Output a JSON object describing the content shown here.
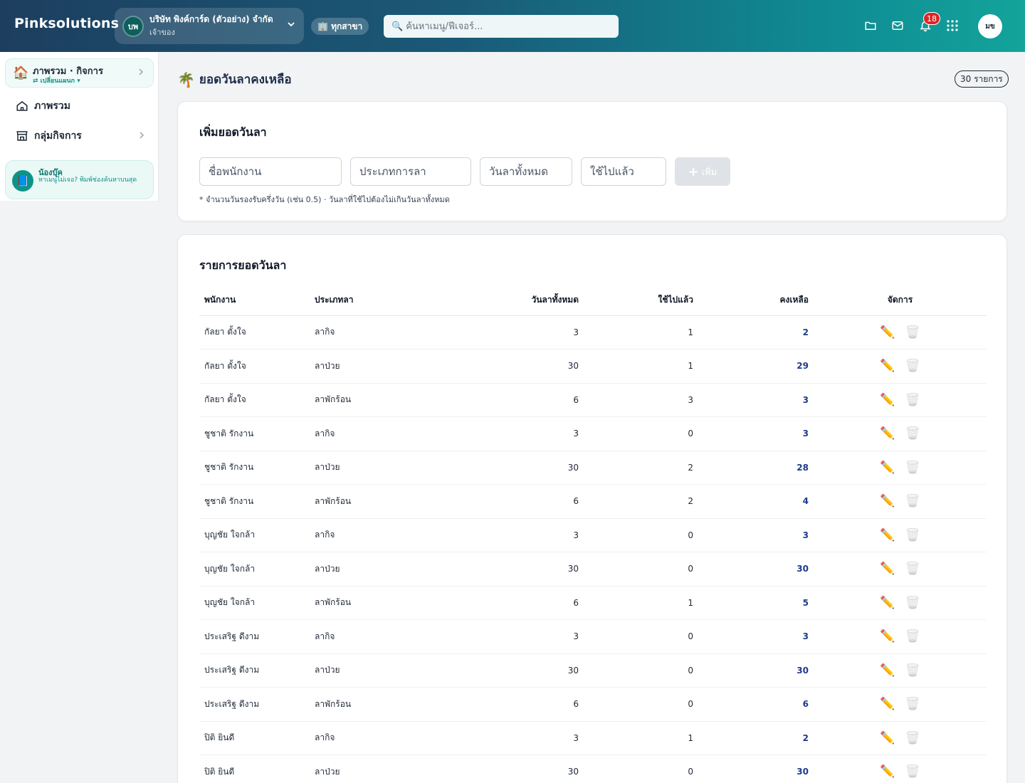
{
  "header": {
    "brand": "Pinksolutions",
    "company": {
      "initials": "บพ",
      "name": "บริษัท พิงค์การ์ด (ตัวอย่าง) จำกัด",
      "role": "เจ้าของ"
    },
    "branch_label": "🏢 ทุกสาขา",
    "search_placeholder": "ค้นหาเมนู/ฟีเจอร์...",
    "notification_count": "18",
    "user_initials": "มข"
  },
  "sidebar": {
    "workspace": {
      "title": "ภาพรวม · กิจการ",
      "switch_label": "⇄ เปลี่ยนแผนก ▾"
    },
    "items": [
      {
        "label": "ภาพรวม",
        "icon": "home-icon"
      },
      {
        "label": "กลุ่มกิจการ",
        "icon": "store-icon"
      }
    ],
    "helper": {
      "title": "น้องบุ๊ค",
      "text": "หาเมนูไม่เจอ? พิมพ์ช่องค้นหาบนสุด"
    }
  },
  "page": {
    "title": "ยอดวันลาคงเหลือ",
    "count_label": "30 รายการ"
  },
  "add_form": {
    "title": "เพิ่มยอดวันลา",
    "employee_placeholder": "ชื่อพนักงาน",
    "leave_type_placeholder": "ประเภทการลา",
    "total_days_placeholder": "วันลาทั้งหมด",
    "used_placeholder": "ใช้ไปแล้ว",
    "add_label": "เพิ่ม",
    "hint": "* จำนวนวันรองรับครึ่งวัน (เช่น 0.5) · วันลาที่ใช้ไปต้องไม่เกินวันลาทั้งหมด"
  },
  "list": {
    "title": "รายการยอดวันลา",
    "columns": [
      "พนักงาน",
      "ประเภทลา",
      "วันลาทั้งหมด",
      "ใช้ไปแล้ว",
      "คงเหลือ",
      "จัดการ"
    ],
    "rows": [
      {
        "employee": "กัลยา ตั้งใจ",
        "type": "ลากิจ",
        "total": "3",
        "used": "1",
        "remaining": "2"
      },
      {
        "employee": "กัลยา ตั้งใจ",
        "type": "ลาป่วย",
        "total": "30",
        "used": "1",
        "remaining": "29"
      },
      {
        "employee": "กัลยา ตั้งใจ",
        "type": "ลาพักร้อน",
        "total": "6",
        "used": "3",
        "remaining": "3"
      },
      {
        "employee": "ชูชาติ รักงาน",
        "type": "ลากิจ",
        "total": "3",
        "used": "0",
        "remaining": "3"
      },
      {
        "employee": "ชูชาติ รักงาน",
        "type": "ลาป่วย",
        "total": "30",
        "used": "2",
        "remaining": "28"
      },
      {
        "employee": "ชูชาติ รักงาน",
        "type": "ลาพักร้อน",
        "total": "6",
        "used": "2",
        "remaining": "4"
      },
      {
        "employee": "บุญชัย ใจกล้า",
        "type": "ลากิจ",
        "total": "3",
        "used": "0",
        "remaining": "3"
      },
      {
        "employee": "บุญชัย ใจกล้า",
        "type": "ลาป่วย",
        "total": "30",
        "used": "0",
        "remaining": "30"
      },
      {
        "employee": "บุญชัย ใจกล้า",
        "type": "ลาพักร้อน",
        "total": "6",
        "used": "1",
        "remaining": "5"
      },
      {
        "employee": "ประเสริฐ ดีงาม",
        "type": "ลากิจ",
        "total": "3",
        "used": "0",
        "remaining": "3"
      },
      {
        "employee": "ประเสริฐ ดีงาม",
        "type": "ลาป่วย",
        "total": "30",
        "used": "0",
        "remaining": "30"
      },
      {
        "employee": "ประเสริฐ ดีงาม",
        "type": "ลาพักร้อน",
        "total": "6",
        "used": "0",
        "remaining": "6"
      },
      {
        "employee": "ปิติ ยินดี",
        "type": "ลากิจ",
        "total": "3",
        "used": "1",
        "remaining": "2"
      },
      {
        "employee": "ปิติ ยินดี",
        "type": "ลาป่วย",
        "total": "30",
        "used": "0",
        "remaining": "30"
      }
    ]
  },
  "colors": {
    "accent": "#0f9488",
    "remaining_text": "#1e3a8a",
    "badge": "#dc2626"
  }
}
